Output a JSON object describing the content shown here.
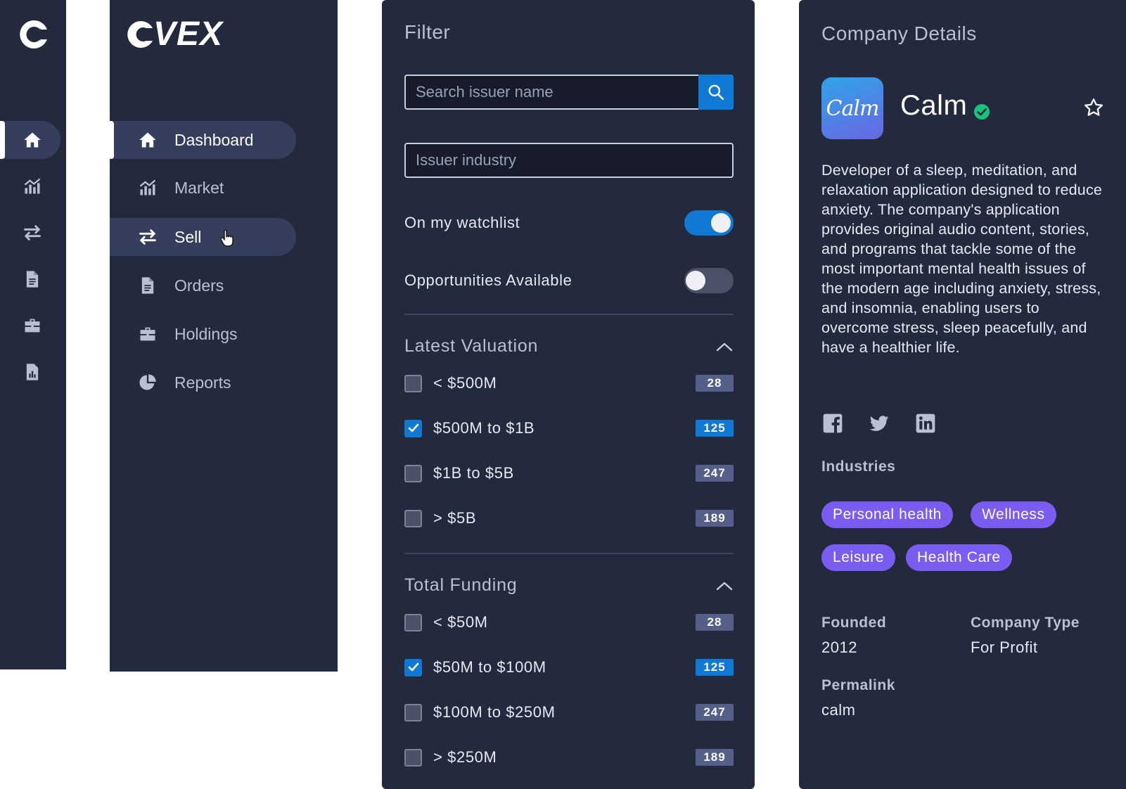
{
  "rail": {
    "items": [
      {
        "icon": "home-icon",
        "active": true
      },
      {
        "icon": "chart-icon",
        "active": false
      },
      {
        "icon": "swap-icon",
        "active": false
      },
      {
        "icon": "document-icon",
        "active": false
      },
      {
        "icon": "briefcase-icon",
        "active": false
      },
      {
        "icon": "report-icon",
        "active": false
      }
    ]
  },
  "sidebar": {
    "brand": "VEX",
    "items": [
      {
        "label": "Dashboard",
        "icon": "home-icon",
        "state": "active"
      },
      {
        "label": "Market",
        "icon": "chart-icon",
        "state": "default"
      },
      {
        "label": "Sell",
        "icon": "swap-icon",
        "state": "hover"
      },
      {
        "label": "Orders",
        "icon": "document-icon",
        "state": "default"
      },
      {
        "label": "Holdings",
        "icon": "briefcase-icon",
        "state": "default"
      },
      {
        "label": "Reports",
        "icon": "pie-icon",
        "state": "default"
      }
    ]
  },
  "filter": {
    "title": "Filter",
    "search_placeholder": "Search issuer name",
    "industry_placeholder": "Issuer industry",
    "watchlist": {
      "label": "On my watchlist",
      "on": true
    },
    "opportunities": {
      "label": "Opportunities Available",
      "on": false
    },
    "valuation": {
      "title": "Latest Valuation",
      "options": [
        {
          "label": "< $500M",
          "count": "28",
          "checked": false
        },
        {
          "label": "$500M to $1B",
          "count": "125",
          "checked": true
        },
        {
          "label": "$1B to $5B",
          "count": "247",
          "checked": false
        },
        {
          "label": "> $5B",
          "count": "189",
          "checked": false
        }
      ]
    },
    "funding": {
      "title": "Total Funding",
      "options": [
        {
          "label": "< $50M",
          "count": "28",
          "checked": false
        },
        {
          "label": "$50M to $100M",
          "count": "125",
          "checked": true
        },
        {
          "label": "$100M to $250M",
          "count": "247",
          "checked": false
        },
        {
          "label": "> $250M",
          "count": "189",
          "checked": false
        }
      ]
    }
  },
  "company": {
    "title": "Company Details",
    "logo_text": "Calm",
    "name": "Calm",
    "description": "Developer of a sleep, meditation, and relaxation application designed to reduce anxiety. The company's application provides original audio content, stories, and programs that tackle some of the most important mental health issues of the modern age including anxiety, stress, and insomnia, enabling users to overcome stress, sleep peacefully, and have a healthier life.",
    "industries_label": "Industries",
    "industries": [
      "Personal health",
      "Wellness",
      "Leisure",
      "Health Care"
    ],
    "founded_label": "Founded",
    "founded": "2012",
    "type_label": "Company Type",
    "type": "For Profit",
    "permalink_label": "Permalink",
    "permalink": "calm"
  },
  "colors": {
    "panel": "#242a3e",
    "active_bg": "#353e5d",
    "accent": "#1079d4",
    "chip": "#7a5cf0",
    "verified": "#19c37d"
  }
}
